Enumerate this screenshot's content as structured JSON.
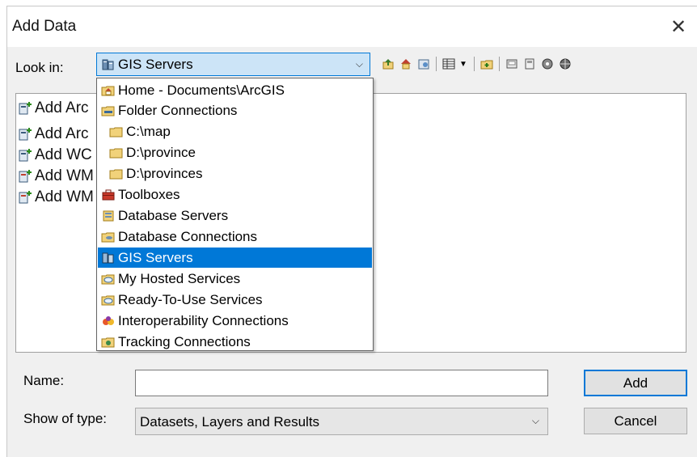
{
  "window": {
    "title": "Add Data",
    "close_glyph": "✕"
  },
  "lookin": {
    "label": "Look in:",
    "value": "GIS Servers",
    "icon": "gis-servers-icon",
    "arrow": "⌵"
  },
  "toolbar": {
    "icons": [
      "up-one-level-icon",
      "home-icon",
      "catalog-icon",
      "view-list-icon",
      "new-folder-icon",
      "disconnect-icon",
      "connect-icon",
      "options-icon",
      "globe-icon"
    ]
  },
  "browser": {
    "items": [
      {
        "label": "Add Arc",
        "icon": "add-server-icon"
      },
      {
        "label": "Add Arc",
        "icon": "add-server-icon"
      },
      {
        "label": "Add WC",
        "icon": "add-server-icon"
      },
      {
        "label": "Add WM",
        "icon": "add-server-icon"
      },
      {
        "label": "Add WM",
        "icon": "add-server-icon"
      }
    ]
  },
  "dropdown": {
    "items": [
      {
        "label": "Home - Documents\\ArcGIS",
        "icon": "home-folder-icon",
        "indent": false,
        "selected": false
      },
      {
        "label": "Folder Connections",
        "icon": "folder-connections-icon",
        "indent": false,
        "selected": false
      },
      {
        "label": "C:\\map",
        "icon": "folder-icon",
        "indent": true,
        "selected": false
      },
      {
        "label": "D:\\province",
        "icon": "folder-icon",
        "indent": true,
        "selected": false
      },
      {
        "label": "D:\\provinces",
        "icon": "folder-icon",
        "indent": true,
        "selected": false
      },
      {
        "label": "Toolboxes",
        "icon": "toolbox-icon",
        "indent": false,
        "selected": false
      },
      {
        "label": "Database Servers",
        "icon": "database-server-icon",
        "indent": false,
        "selected": false
      },
      {
        "label": "Database Connections",
        "icon": "database-connection-icon",
        "indent": false,
        "selected": false
      },
      {
        "label": "GIS Servers",
        "icon": "gis-servers-icon",
        "indent": false,
        "selected": true
      },
      {
        "label": "My Hosted Services",
        "icon": "hosted-services-icon",
        "indent": false,
        "selected": false
      },
      {
        "label": "Ready-To-Use Services",
        "icon": "ready-services-icon",
        "indent": false,
        "selected": false
      },
      {
        "label": "Interoperability Connections",
        "icon": "interoperability-icon",
        "indent": false,
        "selected": false
      },
      {
        "label": "Tracking Connections",
        "icon": "tracking-connections-icon",
        "indent": false,
        "selected": false
      }
    ]
  },
  "form": {
    "name_label": "Name:",
    "name_value": "",
    "type_label": "Show of type:",
    "type_value": "Datasets, Layers and Results",
    "type_arrow": "⌵"
  },
  "buttons": {
    "add": "Add",
    "cancel": "Cancel"
  },
  "colors": {
    "accent": "#0078d7",
    "selection": "#0078d7",
    "combo_bg": "#cce4f7",
    "folder": "#e8c25a"
  }
}
